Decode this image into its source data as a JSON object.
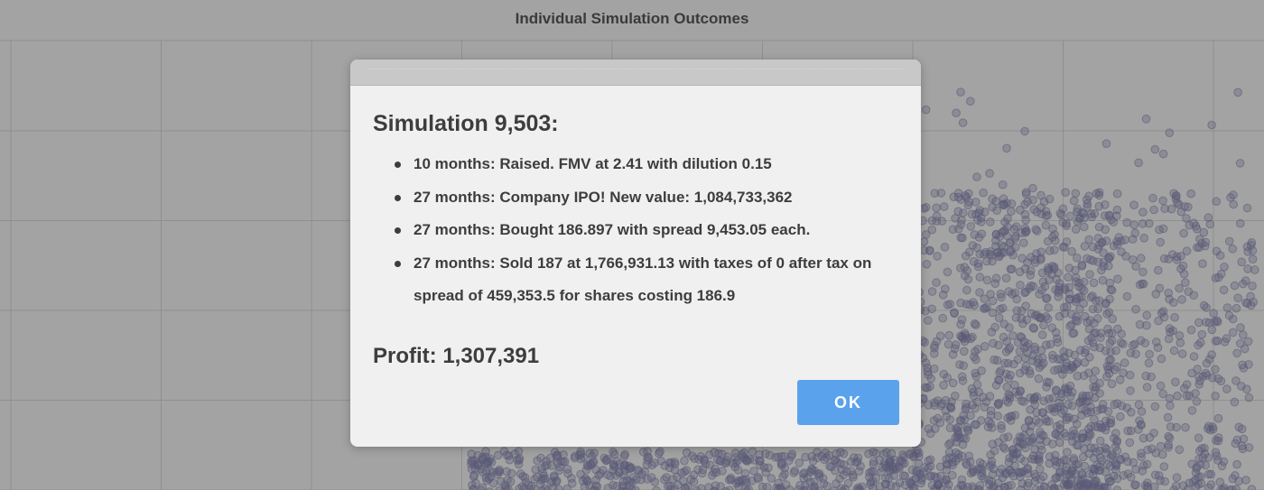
{
  "chart": {
    "title": "Individual Simulation Outcomes",
    "grid_color": "#8f8f8f",
    "point_color": "#5b5b78"
  },
  "modal": {
    "title": "Simulation 9,503:",
    "events": [
      {
        "text": "10 months: Raised. FMV at 2.41 with dilution 0.15"
      },
      {
        "text": "27 months: Company IPO! New value: 1,084,733,362"
      },
      {
        "text": "27 months: Bought 186.897 with spread 9,453.05 each."
      },
      {
        "text": "27 months: Sold 187 at 1,766,931.13 with taxes of 0 after tax on spread of 459,353.5 for shares costing 186.9"
      }
    ],
    "profit": "Profit: 1,307,391",
    "ok_label": "OK"
  },
  "colors": {
    "backdrop": "#a3a3a3",
    "modal_bg": "#f0f0f0",
    "ok_button": "#5aa2ec"
  }
}
